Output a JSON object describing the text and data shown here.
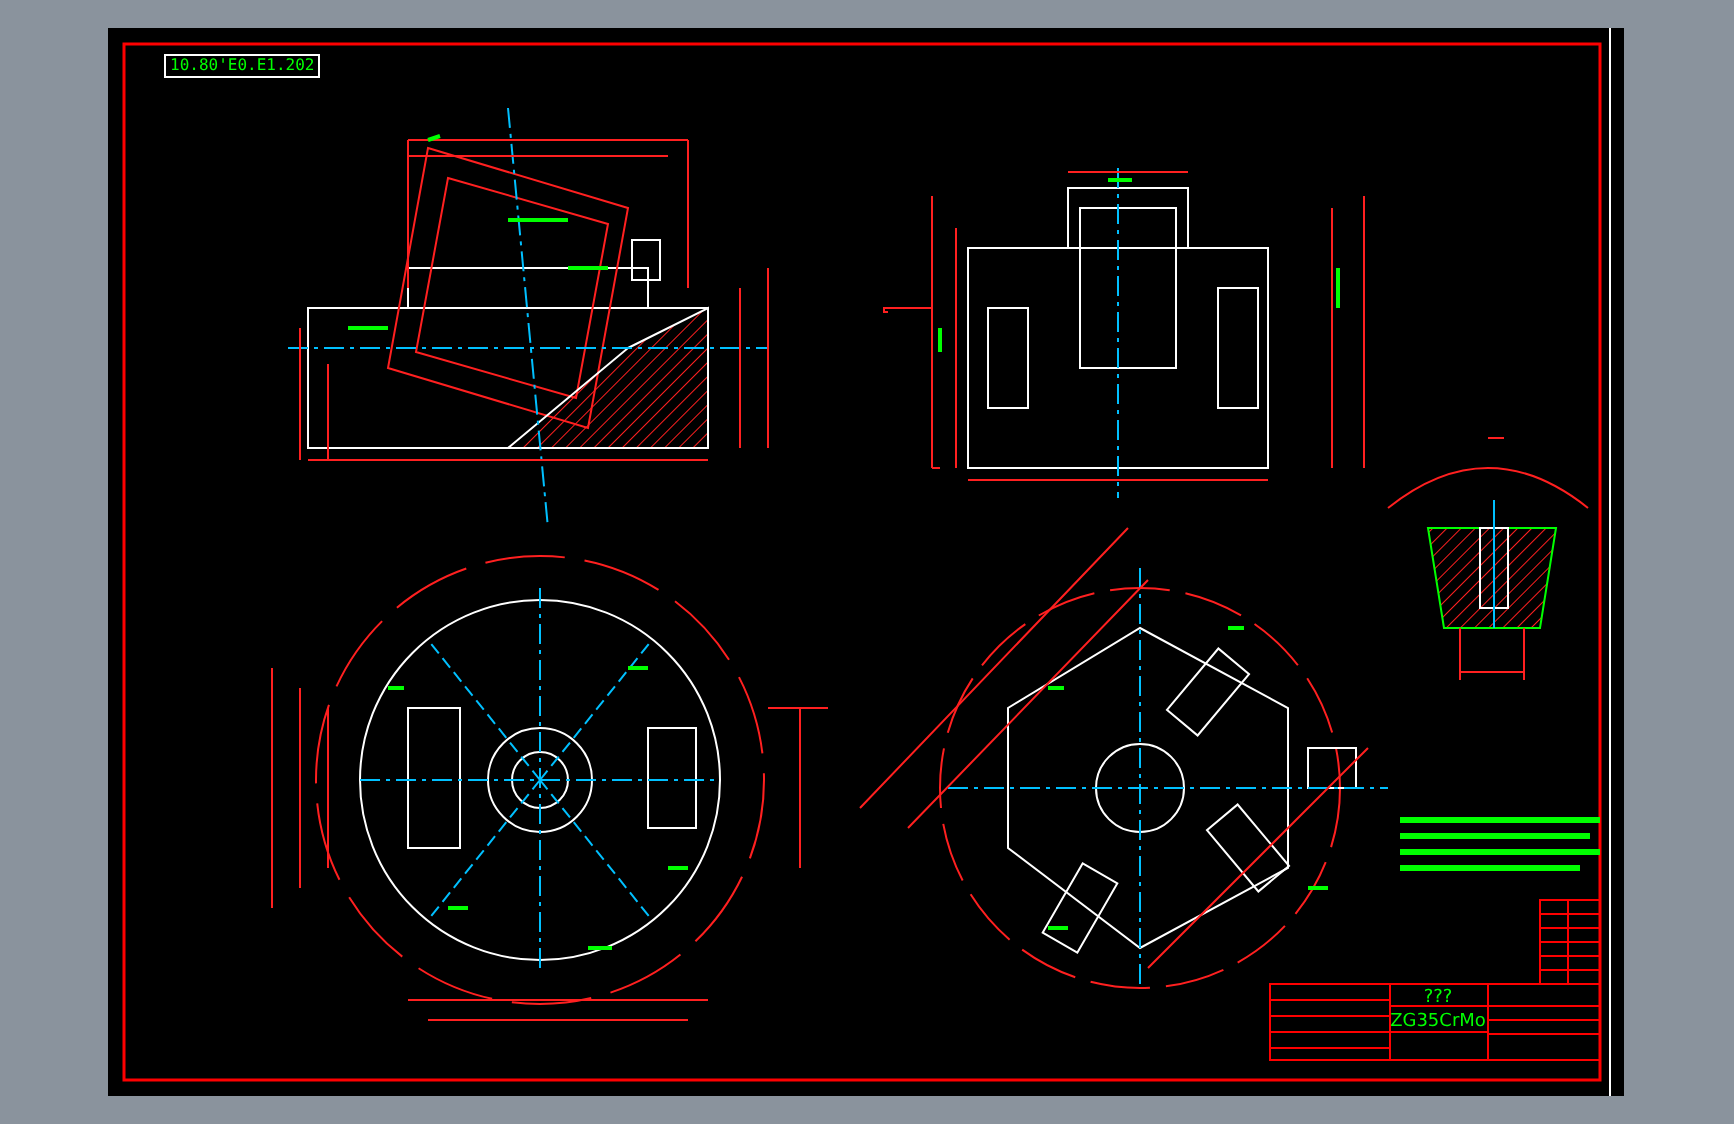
{
  "drawing_label": "10.80'E0.E1.202",
  "title_block": {
    "part_name": "???",
    "material": "ZG35CrMo"
  }
}
